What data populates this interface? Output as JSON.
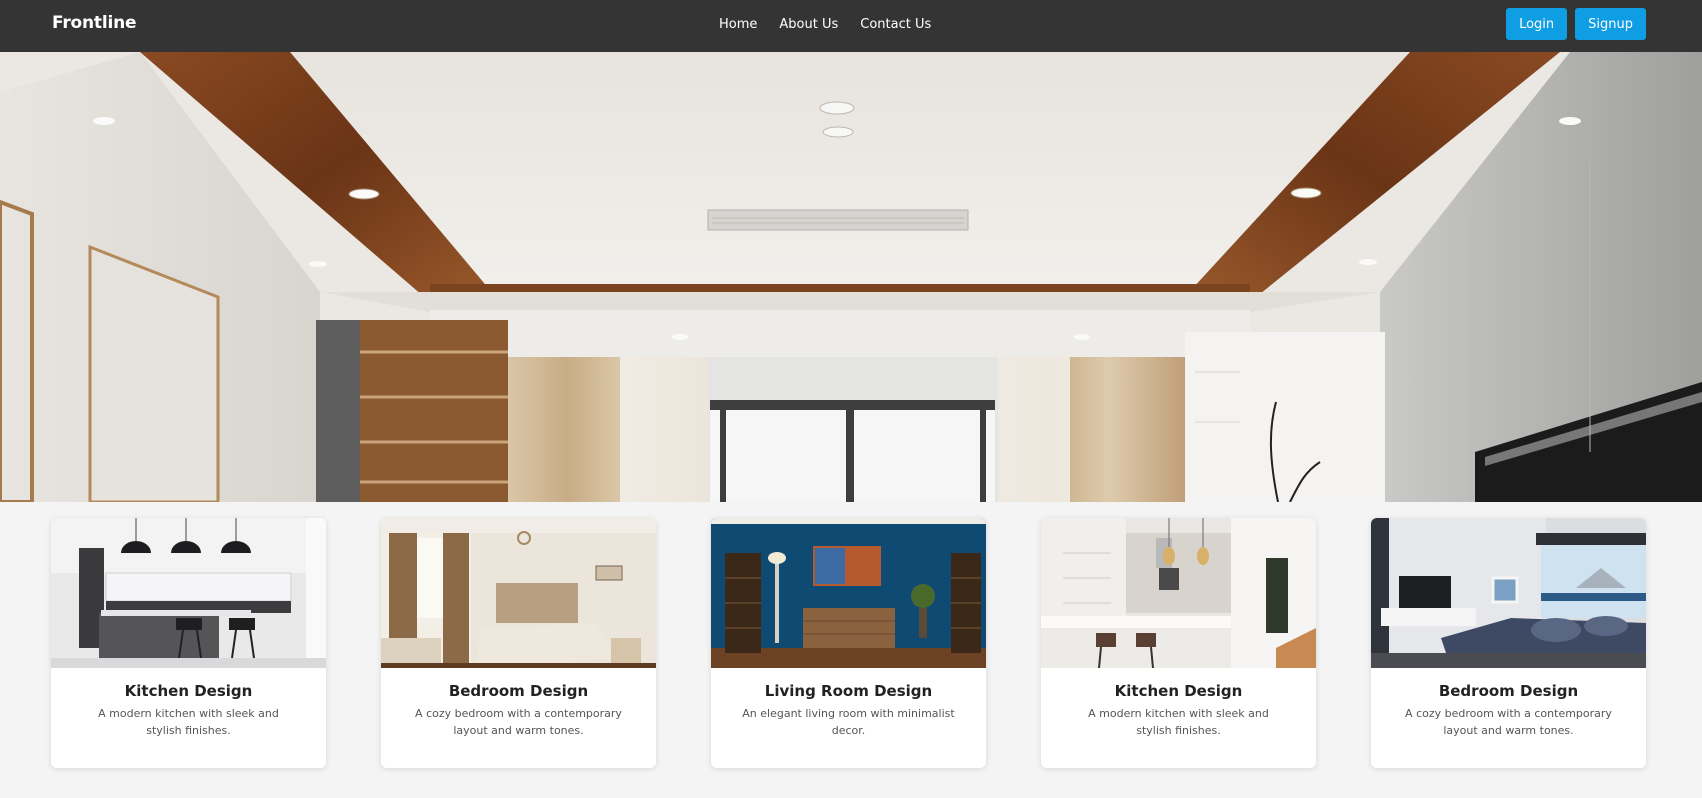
{
  "navbar": {
    "brand": "Frontline",
    "links": [
      "Home",
      "About Us",
      "Contact Us"
    ],
    "login_label": "Login",
    "signup_label": "Signup"
  },
  "hero": {
    "image": "interior-ceiling-photo"
  },
  "cards": [
    {
      "title": "Kitchen Design",
      "description": "A modern kitchen with sleek and stylish finishes.",
      "image": "kitchen-photo"
    },
    {
      "title": "Bedroom Design",
      "description": "A cozy bedroom with a contemporary layout and warm tones.",
      "image": "bedroom-photo"
    },
    {
      "title": "Living Room Design",
      "description": "An elegant living room with minimalist decor.",
      "image": "living-room-photo"
    },
    {
      "title": "Kitchen Design",
      "description": "A modern kitchen with sleek and stylish finishes.",
      "image": "kitchen-photo"
    },
    {
      "title": "Bedroom Design",
      "description": "A cozy bedroom with a contemporary layout and warm tones.",
      "image": "bedroom-photo"
    }
  ],
  "colors": {
    "navbar_bg": "#343434",
    "accent": "#0f9de3",
    "page_bg": "#f4f4f4"
  }
}
